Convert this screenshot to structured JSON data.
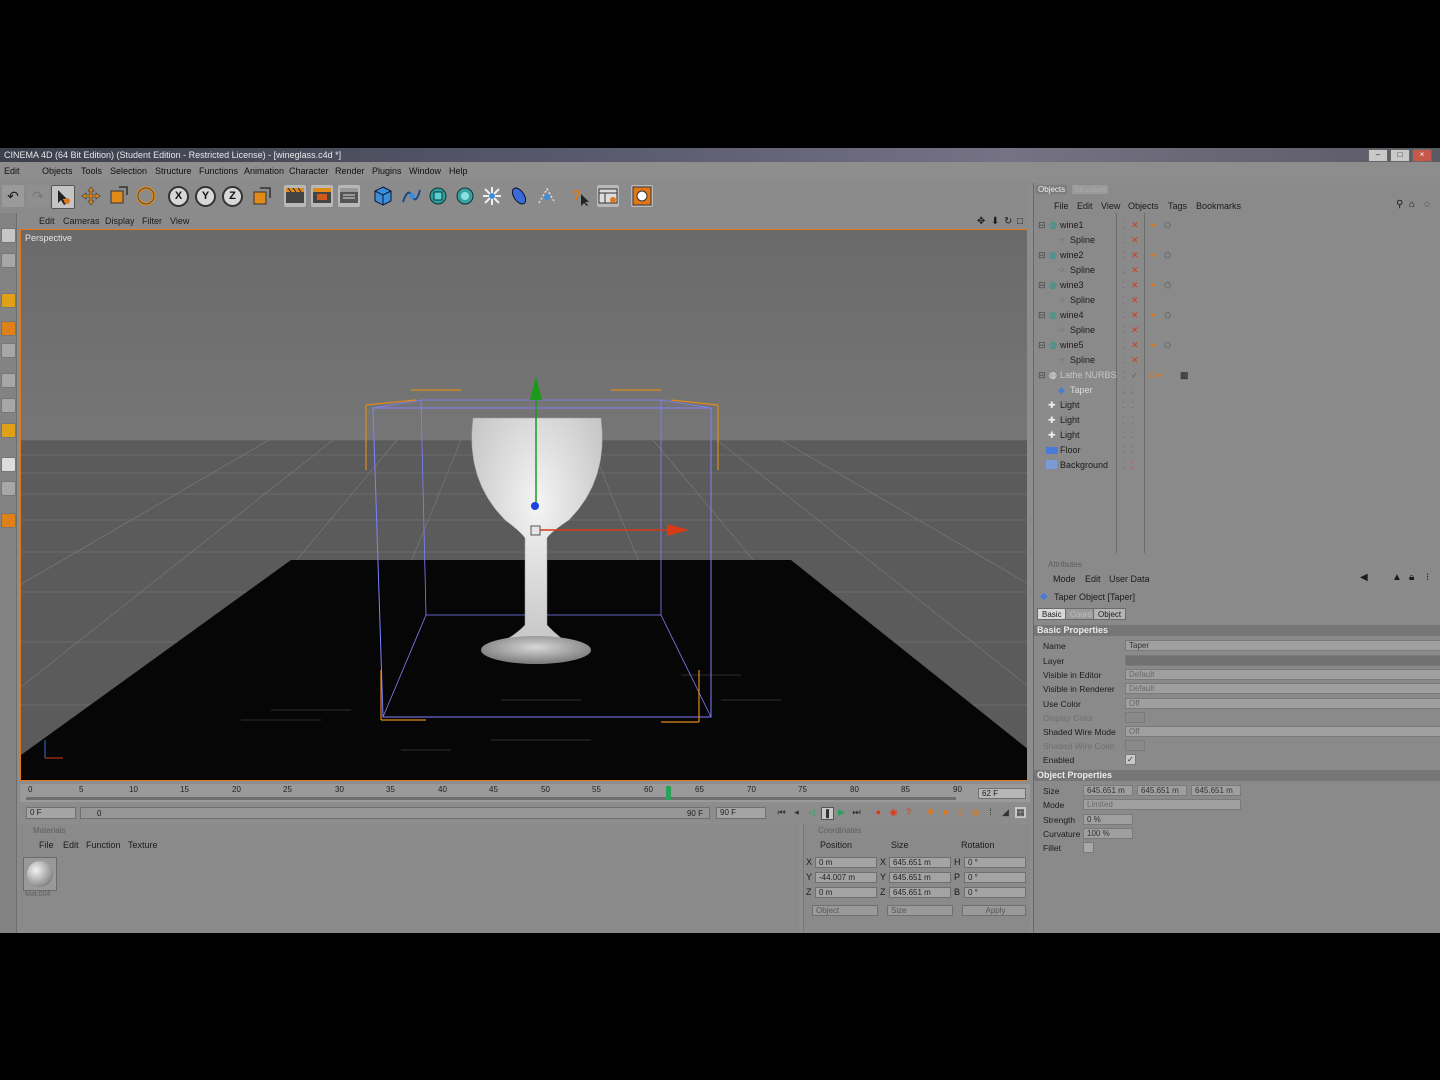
{
  "window": {
    "title": "CINEMA 4D (64 Bit Edition) (Student Edition - Restricted License) - [wineglass.c4d *]"
  },
  "menu": [
    "Edit",
    "Objects",
    "Tools",
    "Selection",
    "Structure",
    "Functions",
    "Animation",
    "Character",
    "Render",
    "Plugins",
    "Window",
    "Help"
  ],
  "toolbar": {
    "axis_x": "X",
    "axis_y": "Y",
    "axis_z": "Z"
  },
  "viewport": {
    "menu": [
      "Edit",
      "Cameras",
      "Display",
      "Filter",
      "View"
    ],
    "label": "Perspective"
  },
  "timeline": {
    "ticks": [
      "0",
      "5",
      "10",
      "15",
      "20",
      "25",
      "30",
      "35",
      "40",
      "45",
      "50",
      "55",
      "60",
      "65",
      "70",
      "75",
      "80",
      "85",
      "90"
    ],
    "current_frame": "62 F",
    "start": "0 F",
    "end": "90 F",
    "range_start": "0",
    "range_end": "90 F"
  },
  "materials": {
    "header": "Materials",
    "menu": [
      "File",
      "Edit",
      "Function",
      "Texture"
    ],
    "item_label": "Mat.004"
  },
  "coordinates": {
    "header": "Coordinates",
    "cols": [
      "Position",
      "Size",
      "Rotation"
    ],
    "rows": [
      {
        "axis": "X",
        "pos": "0 m",
        "size_axis": "X",
        "size": "645.651 m",
        "rot_axis": "H",
        "rot": "0 °"
      },
      {
        "axis": "Y",
        "pos": "-44.007 m",
        "size_axis": "Y",
        "size": "645.651 m",
        "rot_axis": "P",
        "rot": "0 °"
      },
      {
        "axis": "Z",
        "pos": "0 m",
        "size_axis": "Z",
        "size": "645.651 m",
        "rot_axis": "B",
        "rot": "0 °"
      }
    ],
    "mode1": "Object",
    "mode2": "Size",
    "apply": "Apply"
  },
  "objects": {
    "tabs": [
      "Objects",
      "Structure"
    ],
    "menu": [
      "File",
      "Edit",
      "View",
      "Objects",
      "Tags",
      "Bookmarks"
    ],
    "tree": [
      {
        "name": "wine1",
        "indent": 0
      },
      {
        "name": "Spline",
        "indent": 1
      },
      {
        "name": "wine2",
        "indent": 0
      },
      {
        "name": "Spline",
        "indent": 1
      },
      {
        "name": "wine3",
        "indent": 0
      },
      {
        "name": "Spline",
        "indent": 1
      },
      {
        "name": "wine4",
        "indent": 0
      },
      {
        "name": "Spline",
        "indent": 1
      },
      {
        "name": "wine5",
        "indent": 0
      },
      {
        "name": "Spline",
        "indent": 1
      },
      {
        "name": "Lathe NURBS",
        "indent": 0
      },
      {
        "name": "Taper",
        "indent": 1
      },
      {
        "name": "Light",
        "indent": 0
      },
      {
        "name": "Light",
        "indent": 0
      },
      {
        "name": "Light",
        "indent": 0
      },
      {
        "name": "Floor",
        "indent": 0
      },
      {
        "name": "Background",
        "indent": 0
      }
    ]
  },
  "attributes": {
    "header": "Attributes",
    "menu": [
      "Mode",
      "Edit",
      "User Data"
    ],
    "object_title": "Taper Object [Taper]",
    "tabs": [
      "Basic",
      "Coord.",
      "Object"
    ],
    "basic_title": "Basic Properties",
    "basic": [
      {
        "label": "Name",
        "value": "Taper"
      },
      {
        "label": "Layer",
        "value": ""
      },
      {
        "label": "Visible in Editor",
        "value": "Default"
      },
      {
        "label": "Visible in Renderer",
        "value": "Default"
      },
      {
        "label": "Use Color",
        "value": "Off"
      },
      {
        "label": "Display Color",
        "value": ""
      },
      {
        "label": "Shaded Wire Mode",
        "value": "Off"
      },
      {
        "label": "Shaded Wire Color",
        "value": ""
      },
      {
        "label": "Enabled",
        "value": "✓"
      }
    ],
    "object_title2": "Object Properties",
    "size_label": "Size",
    "size_vals": [
      "645.651 m",
      "645.651 m",
      "645.651 m"
    ],
    "mode_label": "Mode",
    "mode_val": "Limited",
    "strength_label": "Strength",
    "strength_val": "0 %",
    "curvature_label": "Curvature",
    "curvature_val": "100 %",
    "fillet_label": "Fillet"
  },
  "colors": {
    "accent": "#e07818",
    "bbox": "#8080ff",
    "axis_y": "#1c9a1c",
    "axis_x": "#d83a18",
    "axis_z": "#2040e0"
  }
}
